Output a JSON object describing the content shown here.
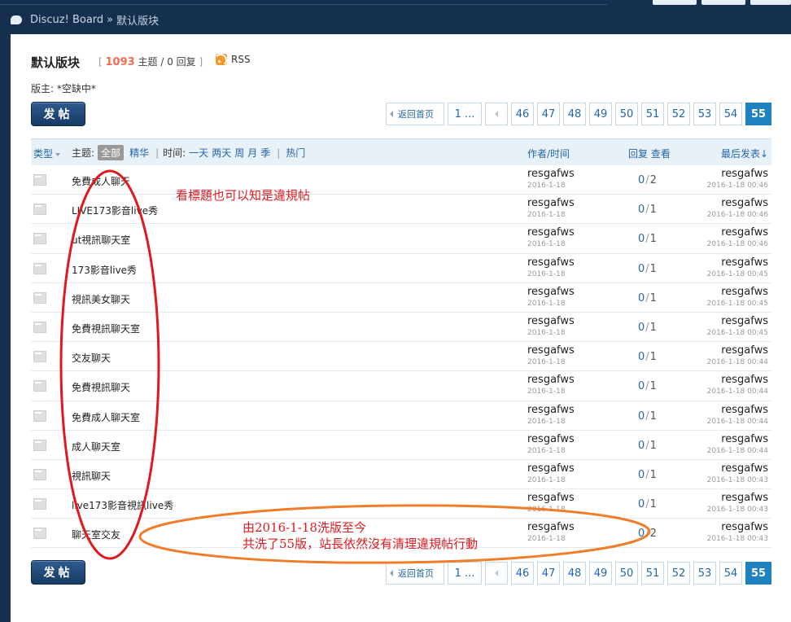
{
  "header": {
    "site_name": "Discuz! Board",
    "separator": "»",
    "current_forum": "默认版块"
  },
  "forum": {
    "title": "默认版块",
    "stats_open": "[",
    "topic_count": "1093",
    "topic_label": "主题 / 0 回复",
    "stats_close": "]",
    "rss_label": "RSS",
    "moderator": "版主: *空缺中*"
  },
  "post_button": {
    "label": "发帖"
  },
  "pagination": {
    "back_label": "返回首页",
    "first_label": "1 ...",
    "pages": [
      "46",
      "47",
      "48",
      "49",
      "50",
      "51",
      "52",
      "53",
      "54"
    ],
    "current": "55"
  },
  "filter_bar": {
    "type_label": "类型",
    "subject_label": "主题:",
    "all_label": "全部",
    "digest_label": "精华",
    "divider": "|",
    "time_label": "时间:",
    "time_options": [
      "一天",
      "两天",
      "周",
      "月",
      "季"
    ],
    "hot_label": "热门",
    "author_col": "作者/时间",
    "reply_col": "回复 查看",
    "last_col": "最后发表↓"
  },
  "topics": [
    {
      "title": "免費成人聊天",
      "author": "resgafws",
      "date": "2016-1-18",
      "replies": "0",
      "views": "2",
      "last_user": "resgafws",
      "last_time": "2016-1-18 00:46"
    },
    {
      "title": "LIVE173影音live秀",
      "author": "resgafws",
      "date": "2016-1-18",
      "replies": "0",
      "views": "1",
      "last_user": "resgafws",
      "last_time": "2016-1-18 00:46"
    },
    {
      "title": "ut視訊聊天室",
      "author": "resgafws",
      "date": "2016-1-18",
      "replies": "0",
      "views": "1",
      "last_user": "resgafws",
      "last_time": "2016-1-18 00:46"
    },
    {
      "title": "173影音live秀",
      "author": "resgafws",
      "date": "2016-1-18",
      "replies": "0",
      "views": "1",
      "last_user": "resgafws",
      "last_time": "2016-1-18 00:45"
    },
    {
      "title": "視訊美女聊天",
      "author": "resgafws",
      "date": "2016-1-18",
      "replies": "0",
      "views": "1",
      "last_user": "resgafws",
      "last_time": "2016-1-18 00:45"
    },
    {
      "title": "免費視訊聊天室",
      "author": "resgafws",
      "date": "2016-1-18",
      "replies": "0",
      "views": "1",
      "last_user": "resgafws",
      "last_time": "2016-1-18 00:45"
    },
    {
      "title": "交友聊天",
      "author": "resgafws",
      "date": "2016-1-18",
      "replies": "0",
      "views": "1",
      "last_user": "resgafws",
      "last_time": "2016-1-18 00:44"
    },
    {
      "title": "免費視訊聊天",
      "author": "resgafws",
      "date": "2016-1-18",
      "replies": "0",
      "views": "1",
      "last_user": "resgafws",
      "last_time": "2016-1-18 00:44"
    },
    {
      "title": "免費成人聊天室",
      "author": "resgafws",
      "date": "2016-1-18",
      "replies": "0",
      "views": "1",
      "last_user": "resgafws",
      "last_time": "2016-1-18 00:44"
    },
    {
      "title": "成人聊天室",
      "author": "resgafws",
      "date": "2016-1-18",
      "replies": "0",
      "views": "1",
      "last_user": "resgafws",
      "last_time": "2016-1-18 00:44"
    },
    {
      "title": "視訊聊天",
      "author": "resgafws",
      "date": "2016-1-18",
      "replies": "0",
      "views": "1",
      "last_user": "resgafws",
      "last_time": "2016-1-18 00:43"
    },
    {
      "title": "live173影音視訊live秀",
      "author": "resgafws",
      "date": "2016-1-18",
      "replies": "0",
      "views": "1",
      "last_user": "resgafws",
      "last_time": "2016-1-18 00:43"
    },
    {
      "title": "聊天室交友",
      "author": "resgafws",
      "date": "2016-1-18",
      "replies": "0",
      "views": "2",
      "last_user": "resgafws",
      "last_time": "2016-1-18 00:43"
    }
  ],
  "annotations": {
    "red_note": "看標題也可以知是違規帖",
    "orange_note_line1": "由2016-1-18洗版至今",
    "orange_note_line2": "共洗了55版，站長依然沒有清理違規帖行動",
    "red_color": "#e0191f",
    "orange_color": "#f07d2a"
  }
}
